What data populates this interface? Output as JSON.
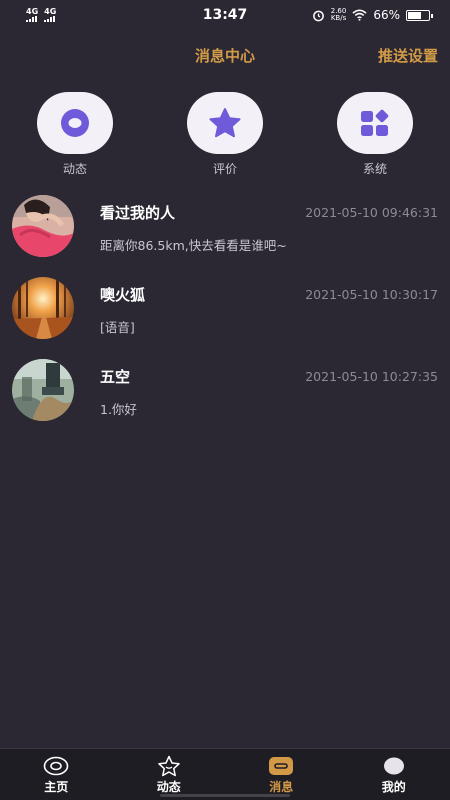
{
  "status_bar": {
    "net1": "4G",
    "net2": "4G",
    "time": "13:47",
    "speed_value": "2.60",
    "speed_unit": "KB/s",
    "battery": "66%",
    "battery_level": 0.66
  },
  "header": {
    "title": "消息中心",
    "action": "推送设置"
  },
  "categories": [
    {
      "label": "动态",
      "icon": "circle-icon"
    },
    {
      "label": "评价",
      "icon": "star-icon"
    },
    {
      "label": "系统",
      "icon": "apps-icon"
    }
  ],
  "messages": [
    {
      "name": "看过我的人",
      "time": "2021-05-10 09:46:31",
      "preview": "距离你86.5km,快去看看是谁吧~"
    },
    {
      "name": "噢火狐",
      "time": "2021-05-10 10:30:17",
      "preview": "[语音]"
    },
    {
      "name": "五空",
      "time": "2021-05-10 10:27:35",
      "preview": "1.你好"
    }
  ],
  "tabbar": [
    {
      "label": "主页",
      "icon": "home-icon",
      "active": false
    },
    {
      "label": "动态",
      "icon": "star-outline-icon",
      "active": false
    },
    {
      "label": "消息",
      "icon": "message-icon",
      "active": true
    },
    {
      "label": "我的",
      "icon": "profile-icon",
      "active": false
    }
  ],
  "colors": {
    "background": "#2b2833",
    "accent": "#d29a47",
    "icon_purple": "#6f5bd9",
    "circle_bg": "#f3f0f7"
  }
}
